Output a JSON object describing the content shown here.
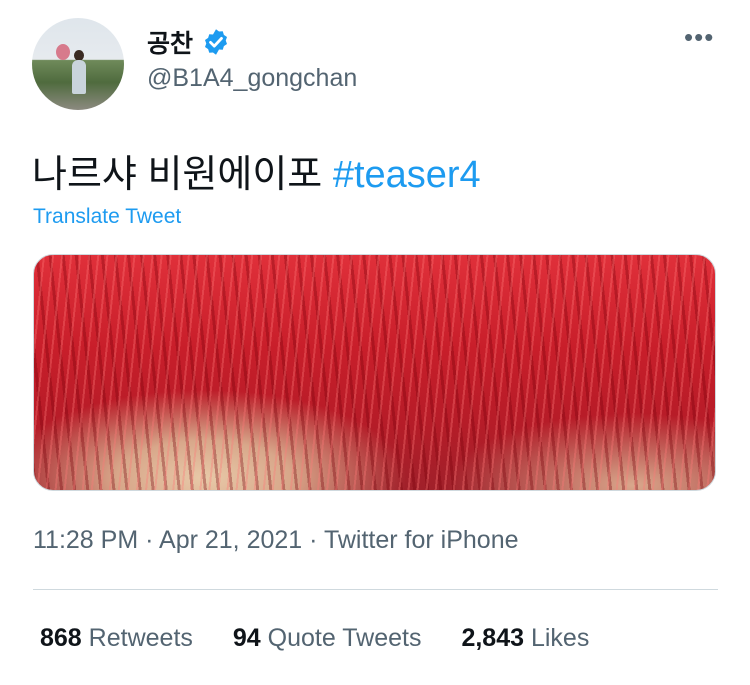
{
  "author": {
    "display_name": "공찬",
    "handle": "@B1A4_gongchan",
    "verified": true
  },
  "tweet": {
    "text": "나르샤 비원에이포",
    "hashtag": "#teaser4",
    "translate_label": "Translate Tweet",
    "time": "11:28 PM",
    "date": "Apr 21, 2021",
    "source": "Twitter for iPhone"
  },
  "stats": {
    "retweets_count": "868",
    "retweets_label": "Retweets",
    "quotes_count": "94",
    "quotes_label": "Quote Tweets",
    "likes_count": "2,843",
    "likes_label": "Likes"
  },
  "icons": {
    "more": "more-options-icon",
    "verified": "verified-badge-icon"
  },
  "colors": {
    "link": "#1d9bf0",
    "secondary_text": "#536471",
    "primary_text": "#0f1419"
  }
}
